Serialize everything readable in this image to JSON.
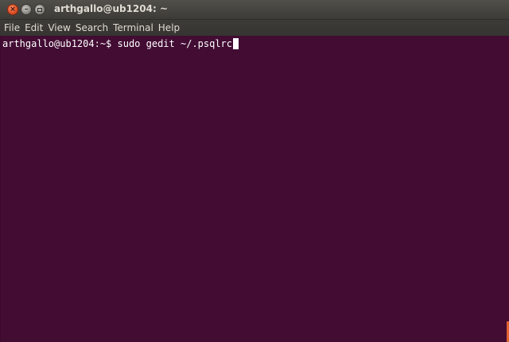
{
  "window": {
    "title": "arthgallo@ub1204: ~",
    "controls": {
      "close_glyph": "×",
      "minimize_glyph": "–"
    }
  },
  "menubar": {
    "items": [
      "File",
      "Edit",
      "View",
      "Search",
      "Terminal",
      "Help"
    ]
  },
  "terminal": {
    "prompt": "arthgallo@ub1204:~$ ",
    "command": "sudo gedit ~/.psqlrc",
    "background_color": "#420c33",
    "text_color": "#ffffff"
  },
  "icons": {
    "close": "close-icon",
    "minimize": "minimize-icon",
    "maximize": "maximize-icon"
  },
  "colors": {
    "titlebar": "#3c3b37",
    "close_button": "#e2532a",
    "resize_grip": "#e1632f"
  }
}
